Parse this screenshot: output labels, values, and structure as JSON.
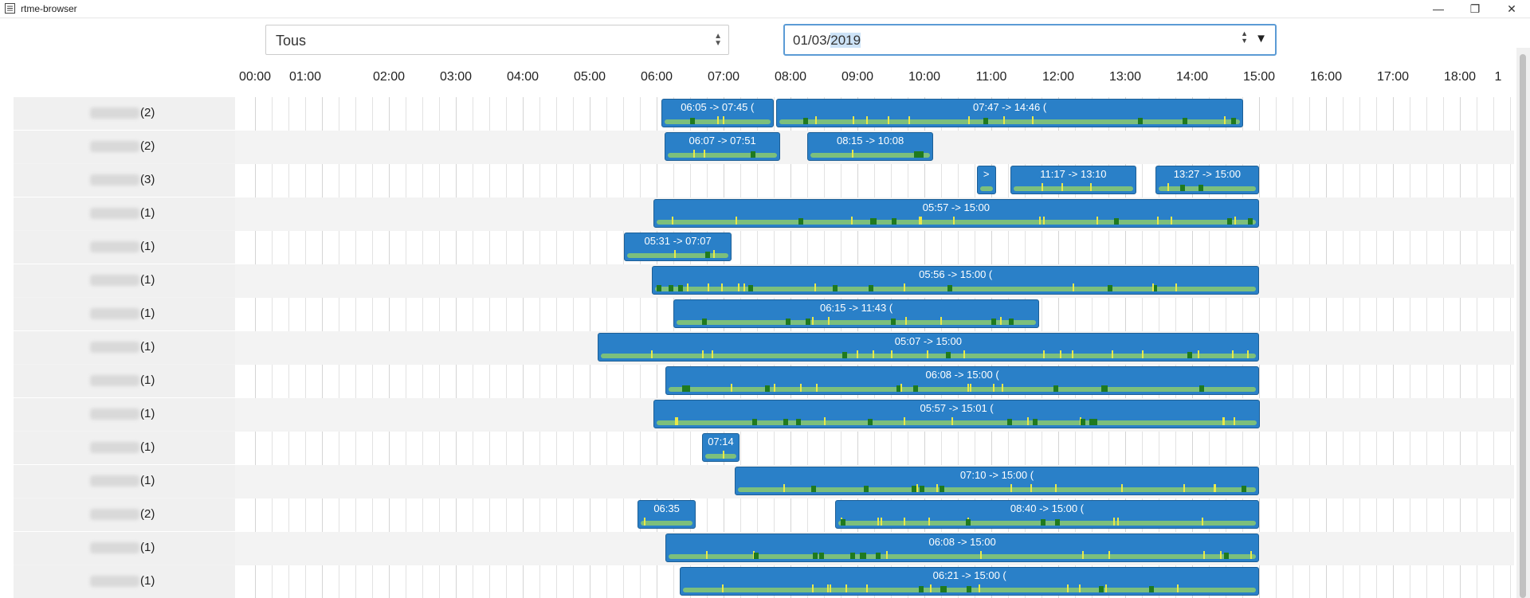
{
  "window": {
    "title": "rtme-browser",
    "minimize_glyph": "—",
    "restore_glyph": "❐",
    "close_glyph": "✕"
  },
  "toolbar": {
    "filter_value": "Tous",
    "date_prefix": "01/03/",
    "date_year": "2019"
  },
  "timeline": {
    "hours": [
      "00:00",
      "01:00",
      "02:00",
      "03:00",
      "04:00",
      "05:00",
      "06:00",
      "07:00",
      "08:00",
      "09:00",
      "10:00",
      "11:00",
      "12:00",
      "13:00",
      "14:00",
      "15:00",
      "16:00",
      "17:00",
      "18:00",
      "1"
    ]
  },
  "rows": [
    {
      "count": "(2)",
      "bars": [
        {
          "label": "06:05 -> 07:45 (",
          "start": "06:04",
          "end": "07:45"
        },
        {
          "label": "07:47 -> 14:46 (",
          "start": "07:47",
          "end": "14:46"
        }
      ]
    },
    {
      "count": "(2)",
      "bars": [
        {
          "label": "06:07 -> 07:51",
          "start": "06:07",
          "end": "07:51"
        },
        {
          "label": "08:15 -> 10:08",
          "start": "08:15",
          "end": "10:08"
        }
      ]
    },
    {
      "count": "(3)",
      "bars": [
        {
          "label": ">",
          "start": "10:47",
          "end": "11:04"
        },
        {
          "label": "11:17 -> 13:10",
          "start": "11:17",
          "end": "13:10"
        },
        {
          "label": "13:27 -> 15:00",
          "start": "13:27",
          "end": "15:00"
        }
      ]
    },
    {
      "count": "(1)",
      "bars": [
        {
          "label": "05:57 -> 15:00",
          "start": "05:57",
          "end": "15:00"
        }
      ]
    },
    {
      "count": "(1)",
      "bars": [
        {
          "label": "05:31 -> 07:07",
          "start": "05:31",
          "end": "07:07"
        }
      ]
    },
    {
      "count": "(1)",
      "bars": [
        {
          "label": "05:56 -> 15:00 (",
          "start": "05:56",
          "end": "15:00"
        }
      ]
    },
    {
      "count": "(1)",
      "bars": [
        {
          "label": "06:15 -> 11:43 (",
          "start": "06:15",
          "end": "11:43"
        }
      ]
    },
    {
      "count": "(1)",
      "bars": [
        {
          "label": "05:07 -> 15:00",
          "start": "05:07",
          "end": "15:00"
        }
      ]
    },
    {
      "count": "(1)",
      "bars": [
        {
          "label": "06:08 -> 15:00 (",
          "start": "06:08",
          "end": "15:00"
        }
      ]
    },
    {
      "count": "(1)",
      "bars": [
        {
          "label": "05:57 -> 15:01 (",
          "start": "05:57",
          "end": "15:01"
        }
      ]
    },
    {
      "count": "(1)",
      "bars": [
        {
          "label": "07:14",
          "start": "06:41",
          "end": "07:14"
        }
      ]
    },
    {
      "count": "(1)",
      "bars": [
        {
          "label": "07:10 -> 15:00 (",
          "start": "07:10",
          "end": "15:00"
        }
      ]
    },
    {
      "count": "(2)",
      "bars": [
        {
          "label": "06:35",
          "start": "05:43",
          "end": "06:35"
        },
        {
          "label": "08:40 -> 15:00 (",
          "start": "08:40",
          "end": "15:00"
        }
      ]
    },
    {
      "count": "(1)",
      "bars": [
        {
          "label": "06:08 -> 15:00",
          "start": "06:08",
          "end": "15:00"
        }
      ]
    },
    {
      "count": "(1)",
      "bars": [
        {
          "label": "06:21 -> 15:00 (",
          "start": "06:21",
          "end": "15:00"
        }
      ]
    }
  ]
}
